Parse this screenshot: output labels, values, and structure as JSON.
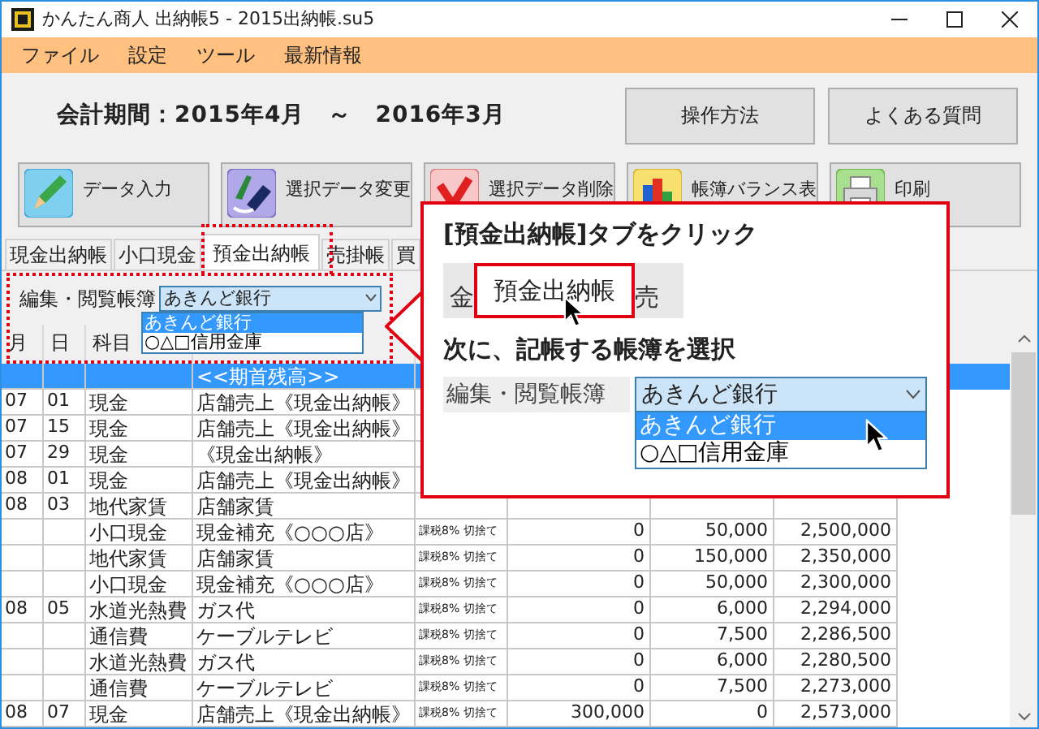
{
  "window": {
    "title": "かんたん商人 出納帳5 - 2015出納帳.su5"
  },
  "menu": [
    "ファイル",
    "設定",
    "ツール",
    "最新情報"
  ],
  "period": "会計期間：2015年4月　～　2016年3月",
  "help_buttons": [
    "操作方法",
    "よくある質問"
  ],
  "toolbar": [
    "データ入力",
    "選択データ変更",
    "選択データ削除",
    "帳簿バランス表",
    "印刷"
  ],
  "tabs": [
    {
      "label": "現金出納帳",
      "selected": false
    },
    {
      "label": "小口現金",
      "selected": false
    },
    {
      "label": "預金出納帳",
      "selected": true
    },
    {
      "label": "売掛帳",
      "selected": false
    },
    {
      "label": "買",
      "selected": false
    }
  ],
  "ledger_select": {
    "label": "編集・閲覧帳簿",
    "value": "あきんど銀行",
    "options": [
      {
        "label": "あきんど銀行",
        "selected": true
      },
      {
        "label": "○△□信用金庫",
        "selected": false
      }
    ]
  },
  "table": {
    "columns": [
      "月",
      "日",
      "科目"
    ],
    "rows": [
      {
        "description": "<<期首残高>>",
        "selected": true
      },
      {
        "month": "07",
        "day": "01",
        "account": "現金",
        "description": "店舗売上《現金出納帳》",
        "selected": false
      },
      {
        "month": "07",
        "day": "15",
        "account": "現金",
        "description": "店舗売上《現金出納帳》",
        "selected": false
      },
      {
        "month": "07",
        "day": "29",
        "account": "現金",
        "description": "《現金出納帳》",
        "selected": false
      },
      {
        "month": "08",
        "day": "01",
        "account": "現金",
        "description": "店舗売上《現金出納帳》",
        "selected": false
      },
      {
        "month": "08",
        "day": "03",
        "account": "地代家賃",
        "description": "店舗家賃",
        "selected": false
      },
      {
        "account": "小口現金",
        "description": "現金補充《○○○店》",
        "tax": "課税8% 切捨て",
        "income": "0",
        "expense": "50,000",
        "balance": "2,500,000",
        "selected": false
      },
      {
        "account": "地代家賃",
        "description": "店舗家賃",
        "tax": "課税8% 切捨て",
        "income": "0",
        "expense": "150,000",
        "balance": "2,350,000",
        "selected": false
      },
      {
        "account": "小口現金",
        "description": "現金補充《○○○店》",
        "tax": "課税8% 切捨て",
        "income": "0",
        "expense": "50,000",
        "balance": "2,300,000",
        "selected": false
      },
      {
        "month": "08",
        "day": "05",
        "account": "水道光熱費",
        "description": "ガス代",
        "tax": "課税8% 切捨て",
        "income": "0",
        "expense": "6,000",
        "balance": "2,294,000",
        "selected": false
      },
      {
        "account": "通信費",
        "description": "ケーブルテレビ",
        "tax": "課税8% 切捨て",
        "income": "0",
        "expense": "7,500",
        "balance": "2,286,500",
        "selected": false
      },
      {
        "account": "水道光熱費",
        "description": "ガス代",
        "tax": "課税8% 切捨て",
        "income": "0",
        "expense": "6,000",
        "balance": "2,280,500",
        "selected": false
      },
      {
        "account": "通信費",
        "description": "ケーブルテレビ",
        "tax": "課税8% 切捨て",
        "income": "0",
        "expense": "7,500",
        "balance": "2,273,000",
        "selected": false
      },
      {
        "month": "08",
        "day": "07",
        "account": "現金",
        "description": "店舗売上《現金出納帳》",
        "tax": "課税8% 切捨て",
        "income": "300,000",
        "expense": "0",
        "balance": "2,573,000",
        "selected": false
      }
    ]
  },
  "callout": {
    "step_1": "[預金出納帳]タブをクリック",
    "tab_strip": [
      {
        "label": "金",
        "selected": false
      },
      {
        "label": "預金出納帳",
        "selected": true
      },
      {
        "label": "売",
        "selected": false
      }
    ],
    "step_2": "次に、記帳する帳簿を選択",
    "select": {
      "label": "編集・閲覧帳簿",
      "value": "あきんど銀行",
      "options": [
        {
          "label": "あきんど銀行",
          "selected": true
        },
        {
          "label": "○△□信用金庫",
          "selected": false
        }
      ]
    }
  }
}
